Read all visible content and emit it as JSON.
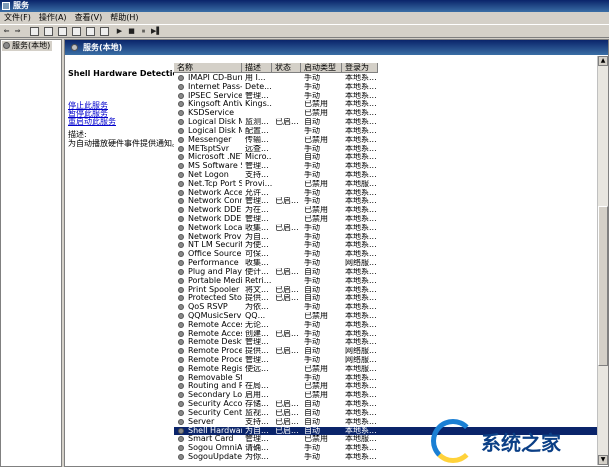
{
  "window": {
    "title": "服务"
  },
  "menu": [
    "文件(F)",
    "操作(A)",
    "查看(V)",
    "帮助(H)"
  ],
  "toolbar": {
    "back": "⇐",
    "forward": "⇒",
    "play": "▶",
    "stop": "■",
    "pause": "⏸",
    "restart": "▶▌"
  },
  "tree": {
    "root_label": "服务(本地)"
  },
  "pane": {
    "header": "服务(本地)",
    "selected_service": "Shell Hardware Detection",
    "action_stop": "停止此服务",
    "action_pause": "暂停此服务",
    "action_restart": "重启动此服务",
    "description_label": "描述:",
    "description_text": "为自动播放硬件事件提供通知。"
  },
  "columns": {
    "name": "名称",
    "desc": "描述",
    "status": "状态",
    "startup": "启动类型",
    "logon": "登录为"
  },
  "services": [
    {
      "name": "IMAPI CD-Burnin...",
      "desc": "用 I...",
      "status": "",
      "startup": "手动",
      "logon": "本地系..."
    },
    {
      "name": "Internet Pass-T...",
      "desc": "Dete...",
      "status": "",
      "startup": "手动",
      "logon": "本地系..."
    },
    {
      "name": "IPSEC Services",
      "desc": "管理...",
      "status": "",
      "startup": "手动",
      "logon": "本地系..."
    },
    {
      "name": "Kingsoft Antiviru...",
      "desc": "Kings...",
      "status": "",
      "startup": "已禁用",
      "logon": "本地系..."
    },
    {
      "name": "KSDService",
      "desc": "",
      "status": "",
      "startup": "已禁用",
      "logon": "本地系..."
    },
    {
      "name": "Logical Disk Man...",
      "desc": "监测...",
      "status": "已启...",
      "startup": "自动",
      "logon": "本地系..."
    },
    {
      "name": "Logical Disk Man...",
      "desc": "配置...",
      "status": "",
      "startup": "手动",
      "logon": "本地系..."
    },
    {
      "name": "Messenger",
      "desc": "传输...",
      "status": "",
      "startup": "已禁用",
      "logon": "本地系..."
    },
    {
      "name": "METsptSvr",
      "desc": "远查...",
      "status": "",
      "startup": "手动",
      "logon": "本地系..."
    },
    {
      "name": "Microsoft .NET F...",
      "desc": "Micro...",
      "status": "",
      "startup": "自动",
      "logon": "本地系..."
    },
    {
      "name": "MS Software Sh...",
      "desc": "管理...",
      "status": "",
      "startup": "手动",
      "logon": "本地系..."
    },
    {
      "name": "Net Logon",
      "desc": "支持...",
      "status": "",
      "startup": "手动",
      "logon": "本地系..."
    },
    {
      "name": "Net.Tcp Port Sh...",
      "desc": "Provi...",
      "status": "",
      "startup": "已禁用",
      "logon": "本地服..."
    },
    {
      "name": "Network Access ...",
      "desc": "允许...",
      "status": "",
      "startup": "手动",
      "logon": "本地系..."
    },
    {
      "name": "Network Connec...",
      "desc": "管理...",
      "status": "已启...",
      "startup": "手动",
      "logon": "本地系..."
    },
    {
      "name": "Network DDE",
      "desc": "为在...",
      "status": "",
      "startup": "已禁用",
      "logon": "本地系..."
    },
    {
      "name": "Network DDE DS...",
      "desc": "管理...",
      "status": "",
      "startup": "已禁用",
      "logon": "本地系..."
    },
    {
      "name": "Network Locatio...",
      "desc": "收集...",
      "status": "已启...",
      "startup": "手动",
      "logon": "本地系..."
    },
    {
      "name": "Network Provisi...",
      "desc": "为自...",
      "status": "",
      "startup": "手动",
      "logon": "本地系..."
    },
    {
      "name": "NT LM Security ...",
      "desc": "为使...",
      "status": "",
      "startup": "手动",
      "logon": "本地系..."
    },
    {
      "name": "Office Source E...",
      "desc": "可保...",
      "status": "",
      "startup": "手动",
      "logon": "本地系..."
    },
    {
      "name": "Performance Lo...",
      "desc": "收集...",
      "status": "",
      "startup": "手动",
      "logon": "网络服..."
    },
    {
      "name": "Plug and Play",
      "desc": "使计...",
      "status": "已启...",
      "startup": "自动",
      "logon": "本地系..."
    },
    {
      "name": "Portable Media ...",
      "desc": "Retri...",
      "status": "",
      "startup": "手动",
      "logon": "本地系..."
    },
    {
      "name": "Print Spooler",
      "desc": "将文...",
      "status": "已启...",
      "startup": "自动",
      "logon": "本地系..."
    },
    {
      "name": "Protected Storage",
      "desc": "提供...",
      "status": "已启...",
      "startup": "自动",
      "logon": "本地系..."
    },
    {
      "name": "QoS RSVP",
      "desc": "为依...",
      "status": "",
      "startup": "手动",
      "logon": "本地系..."
    },
    {
      "name": "QQMusicService",
      "desc": "QQ...",
      "status": "",
      "startup": "已禁用",
      "logon": "本地系..."
    },
    {
      "name": "Remote Access ...",
      "desc": "无论...",
      "status": "",
      "startup": "手动",
      "logon": "本地系..."
    },
    {
      "name": "Remote Access ...",
      "desc": "创建...",
      "status": "已启...",
      "startup": "手动",
      "logon": "本地系..."
    },
    {
      "name": "Remote Desktop...",
      "desc": "管理...",
      "status": "",
      "startup": "手动",
      "logon": "本地系..."
    },
    {
      "name": "Remote Procedu...",
      "desc": "提供...",
      "status": "已启...",
      "startup": "自动",
      "logon": "网络服..."
    },
    {
      "name": "Remote Procedu...",
      "desc": "管理...",
      "status": "",
      "startup": "手动",
      "logon": "网络服..."
    },
    {
      "name": "Remote Registry",
      "desc": "使远...",
      "status": "",
      "startup": "已禁用",
      "logon": "本地服..."
    },
    {
      "name": "Removable Stor...",
      "desc": "",
      "status": "",
      "startup": "手动",
      "logon": "本地系..."
    },
    {
      "name": "Routing and Re...",
      "desc": "在局...",
      "status": "",
      "startup": "已禁用",
      "logon": "本地系..."
    },
    {
      "name": "Secondary Logon",
      "desc": "启用...",
      "status": "",
      "startup": "已禁用",
      "logon": "本地系..."
    },
    {
      "name": "Security Accoun...",
      "desc": "存储...",
      "status": "已启...",
      "startup": "自动",
      "logon": "本地系..."
    },
    {
      "name": "Security Center",
      "desc": "监视...",
      "status": "已启...",
      "startup": "自动",
      "logon": "本地系..."
    },
    {
      "name": "Server",
      "desc": "支持...",
      "status": "已启...",
      "startup": "自动",
      "logon": "本地系..."
    },
    {
      "name": "Shell Hardware ...",
      "desc": "为自...",
      "status": "已启...",
      "startup": "自动",
      "logon": "本地系..."
    },
    {
      "name": "Smart Card",
      "desc": "管理...",
      "status": "",
      "startup": "已禁用",
      "logon": "本地服..."
    },
    {
      "name": "Sogou OmniAdd...",
      "desc": "请确...",
      "status": "",
      "startup": "手动",
      "logon": "本地系..."
    },
    {
      "name": "SogouUpdate",
      "desc": "为你...",
      "status": "",
      "startup": "手动",
      "logon": "本地系..."
    }
  ],
  "selected_index": 40,
  "watermark": {
    "text": "系统之家"
  }
}
